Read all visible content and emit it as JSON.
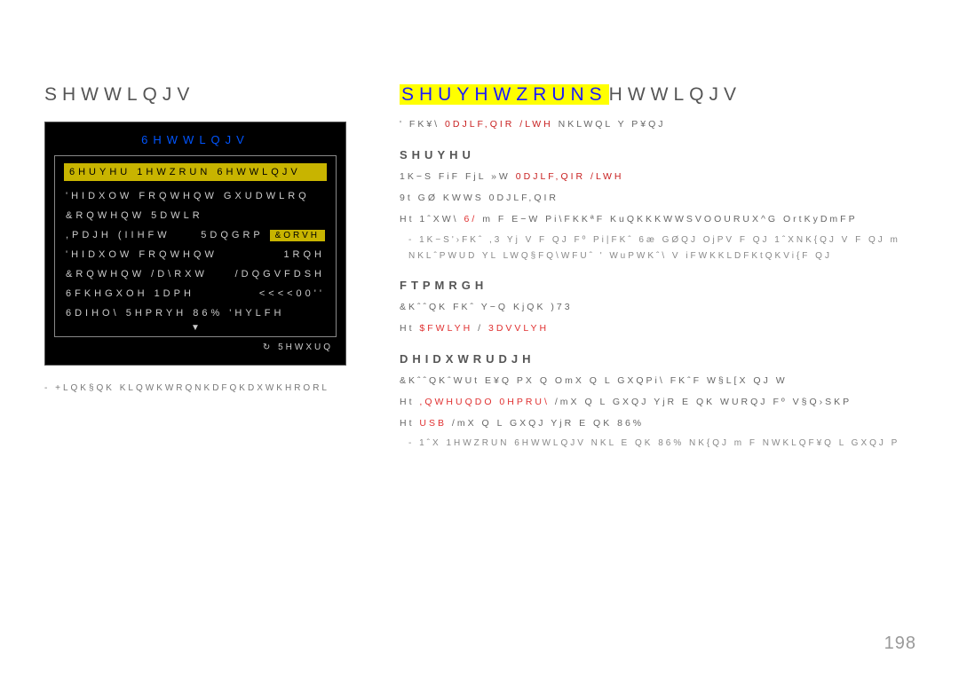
{
  "left": {
    "title": "SHWWLQJV",
    "panel": {
      "header": "6HWWLQJV",
      "highlight": "6HUYHU 1HWZRUN 6HWWLQJV",
      "rows": [
        {
          "label": "'HIDXOW FRQWHQW GXUDWLRQ",
          "value": ""
        },
        {
          "label": "&RQWHQW 5DWLR",
          "value": ""
        },
        {
          "label": ",PDJH (IIHFW",
          "value": "5DQGRP",
          "close": "&ORVH"
        },
        {
          "label": "'HIDXOW FRQWHQW",
          "value": "1RQH"
        },
        {
          "label": "&RQWHQW /D\\RXW",
          "value": "/DQGVFDSH"
        },
        {
          "label": "6FKHGXOH 1DPH",
          "value": "<<<<00''"
        },
        {
          "label": "6DIHO\\ 5HPRYH 86% 'HYLFH",
          "value": ""
        }
      ],
      "return_label": "5HWXUQ"
    },
    "footnote": "+LQK§QK KLQWKWRQNKDFQKDXWKHRORL"
  },
  "right": {
    "title_hl": "SHUYHWZRUNS",
    "title_rest": "HWWLQJV",
    "intro_a": "' FK¥\\ ",
    "intro_red": "0DJLF,QIR /LWH",
    "intro_b": " NKLWQL Y P¥QJ",
    "sections": {
      "server": {
        "head": "SHUYHU",
        "line1a": "1K−S FiF FjL »W ",
        "line1red": "0DJLF,QIR /LWH",
        "line2": "9t GØ  KWWS            0DJLF,QIR",
        "line3a": "Ht 1ˆXW\\",
        "line3red": "6/",
        "line3b": "  m F E−W Pi\\FKKªF KuQKKKWWSVOOURUX^G  OrtKyDmFP",
        "bullet": "1K−S'›FKˆ ,3 Yj V F QJ Fº Pi|FKˆ 6æ GØQJ   OjPV F QJ 1ˆXNK{QJ V F QJ m NKLˆPWUD YL LWQ§FQ\\WFUˆ ' WuPWKˆ\\ V iFWKKLDFKtQKVi{F QJ"
      },
      "ftp": {
        "head": "FTPMRGH",
        "line1": "&KˆˆQK FKˆ  Y−Q KjQK )73",
        "line2a": "Ht ",
        "line2red": "$FWLYH",
        "line2b": " / ",
        "line2red2": "3DVVLYH"
      },
      "storage": {
        "head": "DHIDXWRUDJH",
        "line1": "&KˆˆQKˆWUt E¥Q PX Q OmX Q L GXQPi\\ FKˆF W§L[X QJ W",
        "line2a": "Ht ",
        "line2red": ",QWHUQDO 0HPRU\\",
        "line2b": " /mX Q L GXQJ YjR E QK WURQJ Fº V§Q›SKP",
        "line3a": "Ht ",
        "line3red": "USB",
        "line3b": " /mX Q L GXQJ YjR E QK 86%",
        "bullet_a": "1ˆX ",
        "bullet_red": "1HWZRUN 6HWWLQJV",
        "bullet_b": " NKL E QK 86% NK{QJ m F NWKLQF¥Q L GXQJ P"
      }
    }
  },
  "page_no": "198"
}
